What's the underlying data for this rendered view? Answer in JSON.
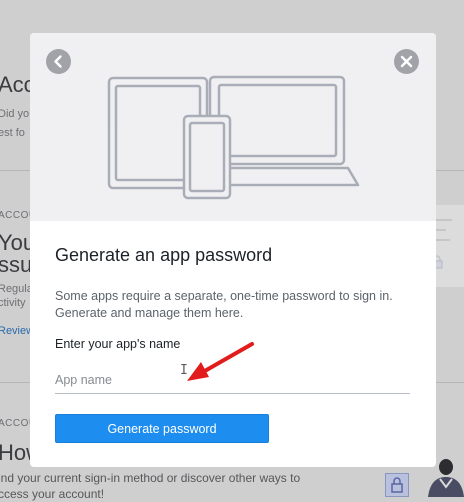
{
  "background": {
    "sections": [
      {
        "title": "Acco",
        "body_lines": [
          "Did yo",
          "est fo"
        ]
      },
      {
        "category": "ACCOU",
        "title_lines": [
          "Your",
          "ssue"
        ],
        "body_lines": [
          "Regula",
          "ctivity"
        ],
        "link": "Review"
      },
      {
        "category": "ACCOU",
        "title": "How",
        "body_lines": [
          "ind your current sign-in method or discover other ways to",
          "ccess your account!"
        ]
      }
    ],
    "icons": {
      "lock": "lock-icon",
      "person": "person-illustration"
    }
  },
  "modal": {
    "icons": {
      "back": "chevron-left-icon",
      "close": "close-icon",
      "hero": "devices-illustration"
    },
    "title": "Generate an app password",
    "description": "Some apps require a separate, one-time password to sign in. Generate and manage them here.",
    "field_label": "Enter your app's name",
    "input": {
      "value": "",
      "placeholder": "App name"
    },
    "button_label": "Generate password"
  },
  "colors": {
    "accent": "#1d8ef0",
    "annotation_arrow": "#e21b1b",
    "overlay": "#cfcfd0"
  }
}
